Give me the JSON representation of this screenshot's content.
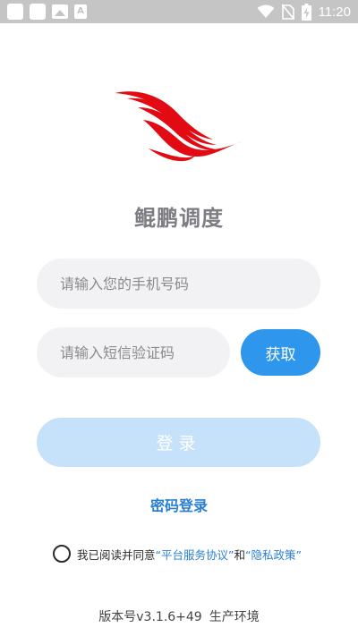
{
  "status_bar": {
    "time": "11:20",
    "icons": [
      "notification-icon",
      "notification-icon",
      "image-icon",
      "font-a-icon",
      "wifi-icon",
      "no-sim-icon",
      "battery-charging-icon"
    ]
  },
  "app": {
    "title": "鲲鹏调度",
    "brand_color": "#e30b13"
  },
  "form": {
    "phone_placeholder": "请输入您的手机号码",
    "phone_value": "",
    "code_placeholder": "请输入短信验证码",
    "code_value": "",
    "get_code_label": "获取",
    "login_label": "登录",
    "password_login_label": "密码登录"
  },
  "agreement": {
    "checked": false,
    "prefix": "我已阅读并同意",
    "service_link": "“平台服务协议”",
    "conjunction": "和",
    "privacy_link": "“隐私政策”"
  },
  "footer": {
    "version_label": "版本号v3.1.6+49",
    "environment": "生产环境"
  },
  "colors": {
    "accent": "#2f96ee",
    "login_disabled": "#c5e2fa",
    "link": "#2a7fd4",
    "field_bg": "#f2f2f4"
  }
}
